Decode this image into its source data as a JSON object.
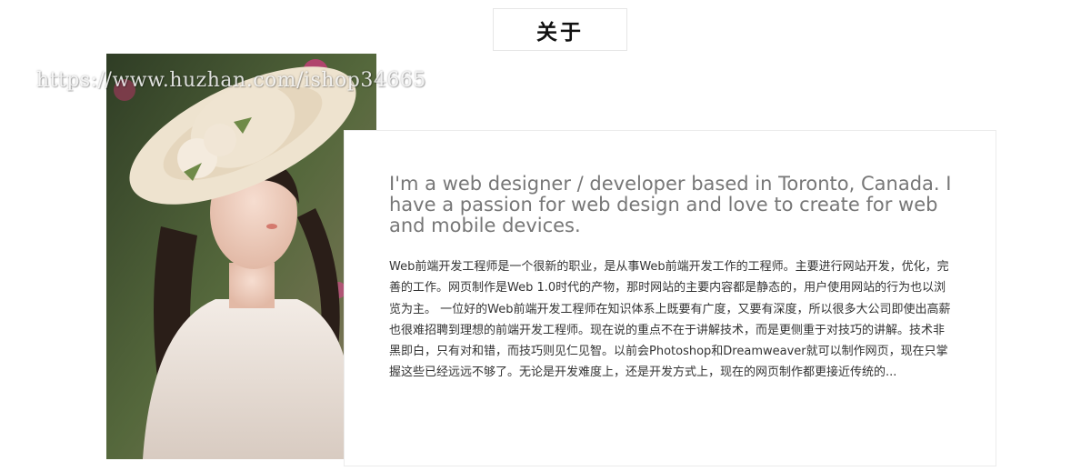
{
  "section": {
    "title": "关于"
  },
  "watermark": {
    "text": "https://www.huzhan.com/ishop34665"
  },
  "about": {
    "headline": "I'm a web designer / developer based in Toronto, Canada. I have a passion for web design and love to create for web and mobile devices.",
    "body": "Web前端开发工程师是一个很新的职业，是从事Web前端开发工作的工程师。主要进行网站开发，优化，完善的工作。网页制作是Web 1.0时代的产物，那时网站的主要内容都是静态的，用户使用网站的行为也以浏览为主。 一位好的Web前端开发工程师在知识体系上既要有广度，又要有深度，所以很多大公司即使出高薪也很难招聘到理想的前端开发工程师。现在说的重点不在于讲解技术，而是更侧重于对技巧的讲解。技术非黑即白，只有对和错，而技巧则见仁见智。以前会Photoshop和Dreamweaver就可以制作网页，现在只掌握这些已经远远不够了。无论是开发难度上，还是开发方式上，现在的网页制作都更接近传统的..."
  },
  "colors": {
    "accent": "#777777",
    "text": "#333333",
    "border": "#ececec"
  }
}
